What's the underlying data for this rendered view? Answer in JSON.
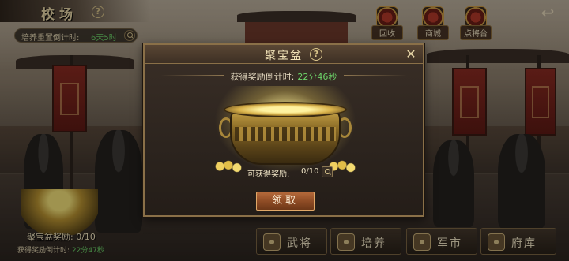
{
  "header": {
    "title": "校场",
    "timer_label": "培养重置倒计时:",
    "timer_value": "6天5时"
  },
  "top_icons": [
    {
      "label": "回收",
      "icon": "recycle-emblem-icon"
    },
    {
      "label": "商城",
      "icon": "shop-emblem-icon"
    },
    {
      "label": "点将台",
      "icon": "general-platform-emblem-icon"
    }
  ],
  "mini_pot": {
    "label": "聚宝盆奖励: 0/10",
    "timer_label": "获得奖励倒计时:",
    "timer_value": "22分47秒"
  },
  "bottom_nav": [
    {
      "label": "武将",
      "icon": "helmet-icon"
    },
    {
      "label": "培养",
      "icon": "training-icon"
    },
    {
      "label": "军市",
      "icon": "market-icon"
    },
    {
      "label": "府库",
      "icon": "treasury-icon"
    }
  ],
  "modal": {
    "title": "聚宝盆",
    "countdown_label": "获得奖励倒计时:",
    "countdown_value": "22分46秒",
    "reward_label": "可获得奖励:",
    "reward_value": "0/10",
    "claim_label": "领取"
  },
  "colors": {
    "accent_green": "#6dd56a",
    "gold_border": "#8a7048",
    "claim_button": "#8c4a24"
  }
}
